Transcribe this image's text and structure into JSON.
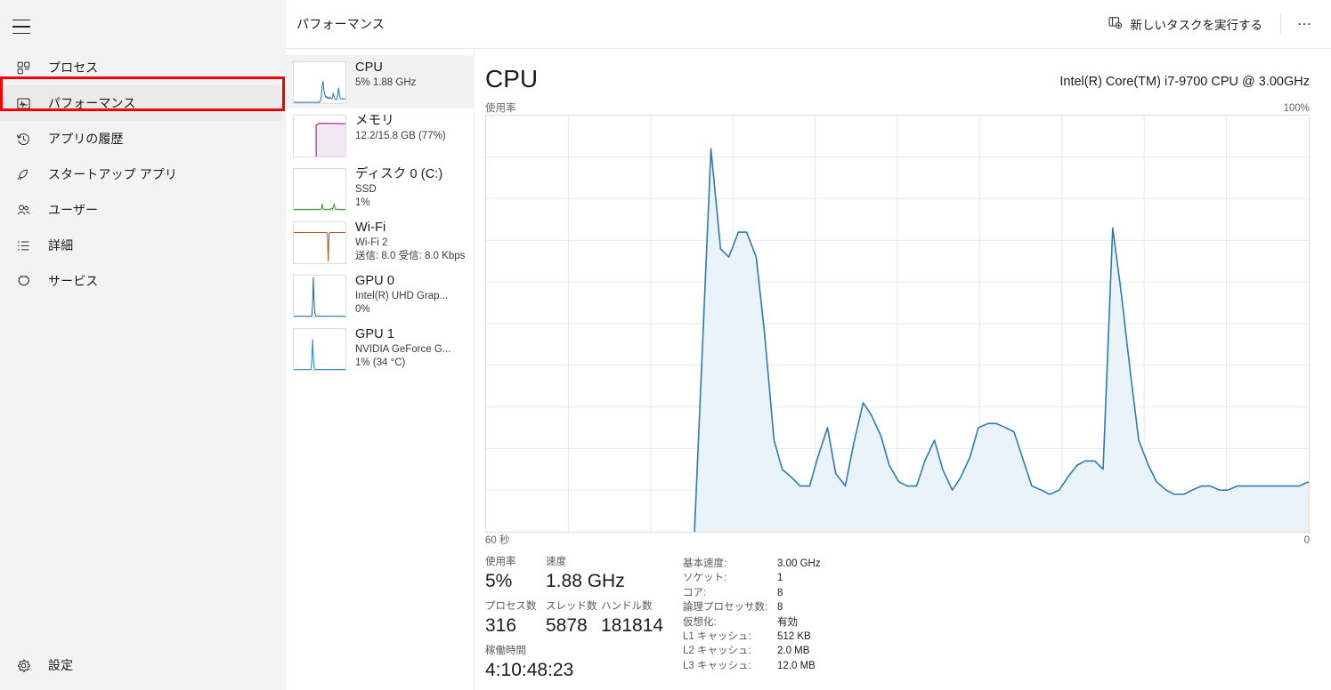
{
  "nav": {
    "menu_icon": "hamburger-icon",
    "items": [
      {
        "id": "processes",
        "label": "プロセス",
        "icon": "processes-icon",
        "selected": false
      },
      {
        "id": "performance",
        "label": "パフォーマンス",
        "icon": "performance-icon",
        "selected": true
      },
      {
        "id": "app-history",
        "label": "アプリの履歴",
        "icon": "history-icon",
        "selected": false
      },
      {
        "id": "startup-apps",
        "label": "スタートアップ アプリ",
        "icon": "startup-icon",
        "selected": false
      },
      {
        "id": "users",
        "label": "ユーザー",
        "icon": "users-icon",
        "selected": false
      },
      {
        "id": "details",
        "label": "詳細",
        "icon": "details-list-icon",
        "selected": false
      },
      {
        "id": "services",
        "label": "サービス",
        "icon": "services-gear-icon",
        "selected": false
      }
    ],
    "settings": {
      "id": "settings",
      "label": "設定",
      "icon": "gear-icon"
    },
    "highlight_color": "#f80000"
  },
  "titlebar": {
    "title": "パフォーマンス",
    "new_task_label": "新しいタスクを実行する",
    "new_task_icon": "new-task-icon",
    "more_label": "…",
    "more_icon": "ellipsis-icon"
  },
  "resources": [
    {
      "id": "cpu",
      "title": "CPU",
      "sub1": "5%  1.88 GHz",
      "sub2": "",
      "selected": true,
      "color": "#2b7cb3"
    },
    {
      "id": "memory",
      "title": "メモリ",
      "sub1": "12.2/15.8 GB (77%)",
      "sub2": "",
      "selected": false,
      "color": "#a4349a"
    },
    {
      "id": "disk0",
      "title": "ディスク 0 (C:)",
      "sub1": "SSD",
      "sub2": "1%",
      "selected": false,
      "color": "#3a9b35"
    },
    {
      "id": "wifi",
      "title": "Wi-Fi",
      "sub1": "Wi-Fi 2",
      "sub2": "送信: 8.0 受信: 8.0 Kbps",
      "selected": false,
      "color": "#b35a1f"
    },
    {
      "id": "gpu0",
      "title": "GPU 0",
      "sub1": "Intel(R) UHD Grap...",
      "sub2": "0%",
      "selected": false,
      "color": "#1f6fb5"
    },
    {
      "id": "gpu1",
      "title": "GPU 1",
      "sub1": "NVIDIA GeForce G...",
      "sub2": "1%  (34 °C)",
      "selected": false,
      "color": "#1f6fb5"
    }
  ],
  "detail": {
    "heading": "CPU",
    "model": "Intel(R) Core(TM) i7-9700 CPU @ 3.00GHz",
    "graph_label": "使用率",
    "graph_max": "100%",
    "graph_time_left": "60 秒",
    "graph_time_right": "0",
    "line_color": "#2b7cb3",
    "fill_color": "#eaf3fa",
    "grid_color": "#e8e8e8"
  },
  "stats": {
    "utilization_label": "使用率",
    "utilization_value": "5%",
    "speed_label": "速度",
    "speed_value": "1.88 GHz",
    "processes_label": "プロセス数",
    "processes_value": "316",
    "threads_label": "スレッド数",
    "threads_value": "5878",
    "handles_label": "ハンドル数",
    "handles_value": "181814",
    "uptime_label": "稼働時間",
    "uptime_value": "4:10:48:23",
    "specs": [
      {
        "key": "基本速度:",
        "value": "3.00 GHz"
      },
      {
        "key": "ソケット:",
        "value": "1"
      },
      {
        "key": "コア:",
        "value": "8"
      },
      {
        "key": "論理プロセッサ数:",
        "value": "8"
      },
      {
        "key": "仮想化:",
        "value": "有効"
      },
      {
        "key": "L1 キャッシュ:",
        "value": "512 KB"
      },
      {
        "key": "L2 キャッシュ:",
        "value": "2.0 MB"
      },
      {
        "key": "L3 キャッシュ:",
        "value": "12.0 MB"
      }
    ]
  },
  "chart_data": {
    "type": "area",
    "title": "CPU 使用率",
    "xlabel": "60 秒",
    "ylabel": "使用率",
    "ylim": [
      0,
      100
    ],
    "xlim": [
      60,
      0
    ],
    "grid": true,
    "grid_cols": 10,
    "grid_rows": 10,
    "x": [
      44.8,
      44.2,
      43.6,
      42.9,
      42.3,
      41.6,
      41.0,
      40.3,
      39.7,
      39.0,
      38.4,
      37.7,
      37.1,
      36.4,
      35.8,
      35.1,
      34.5,
      33.8,
      33.2,
      32.5,
      31.9,
      31.2,
      30.6,
      29.9,
      29.3,
      28.6,
      28.0,
      27.3,
      26.7,
      26.0,
      25.4,
      24.7,
      24.1,
      23.4,
      22.8,
      22.1,
      21.5,
      20.8,
      20.2,
      19.5,
      18.9,
      18.2,
      17.6,
      16.9,
      16.3,
      15.6,
      15.0,
      14.3,
      13.7,
      13.0,
      12.4,
      11.7,
      11.1,
      10.4,
      9.8,
      9.1,
      8.5,
      7.8,
      7.2,
      6.5,
      5.9,
      5.2,
      4.6,
      3.9,
      3.3,
      2.6,
      2.0,
      1.3,
      0.7,
      0.0
    ],
    "values": [
      0,
      46,
      92,
      68,
      66,
      72,
      72,
      66,
      48,
      22,
      15,
      13,
      11,
      11,
      18,
      25,
      14,
      11,
      21,
      31,
      28,
      23,
      16,
      12,
      11,
      11,
      17,
      22,
      15,
      10,
      13,
      18,
      25,
      26,
      26,
      25,
      24,
      17,
      11,
      10,
      9,
      10,
      13,
      16,
      17,
      17,
      15,
      73,
      58,
      38,
      22,
      16,
      12,
      10,
      9,
      9,
      10,
      11,
      11,
      10,
      10,
      11,
      11,
      11,
      11,
      11,
      11,
      11,
      11,
      12
    ],
    "series_name": "CPU 使用率 (%)",
    "line_color": "#2b7cb3",
    "fill_color": "#eaf3fa"
  }
}
